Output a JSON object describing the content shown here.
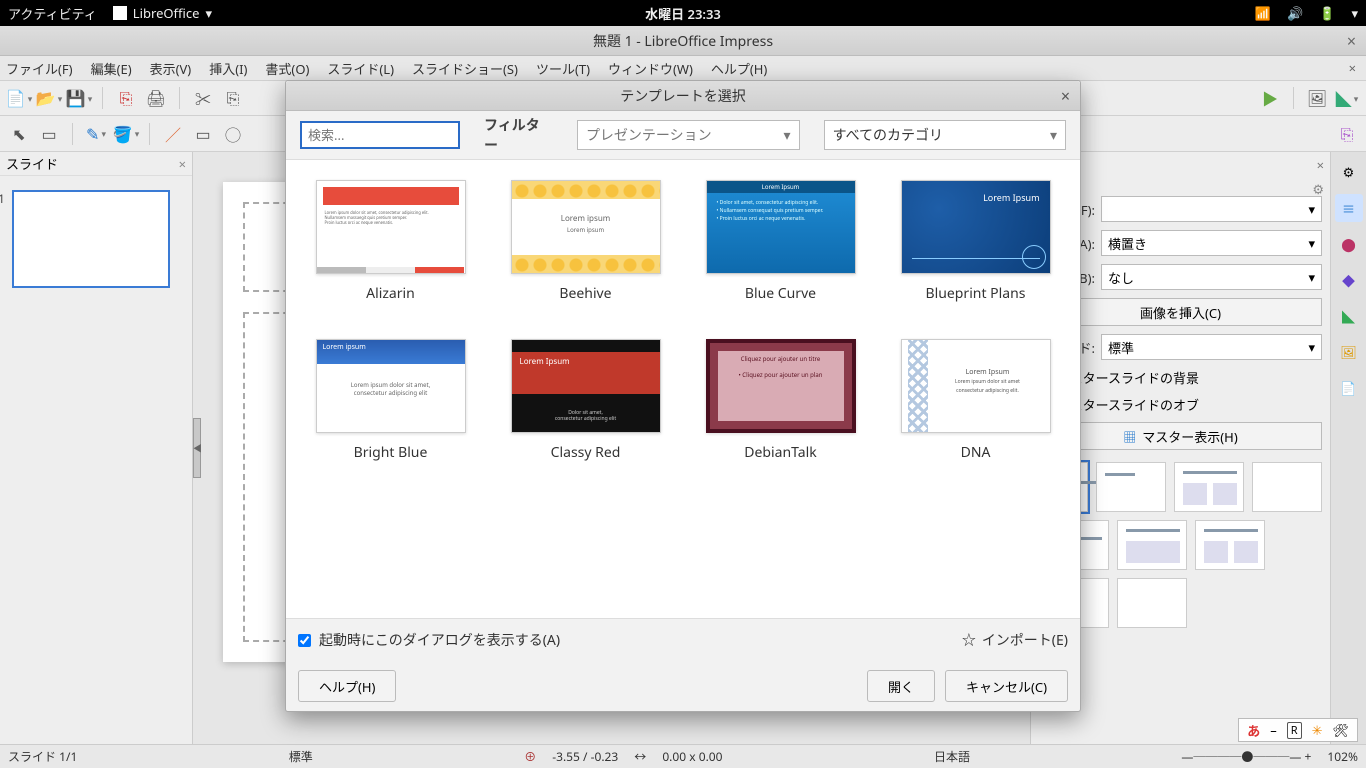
{
  "gnome": {
    "activities": "アクティビティ",
    "app": "LibreOffice",
    "clock": "水曜日 23:33"
  },
  "window": {
    "title": "無題 1 - LibreOffice Impress"
  },
  "menu": [
    "ファイル(F)",
    "編集(E)",
    "表示(V)",
    "挿入(I)",
    "書式(O)",
    "スライド(L)",
    "スライドショー(S)",
    "ツール(T)",
    "ウィンドウ(W)",
    "ヘルプ(H)"
  ],
  "slidepanel": {
    "title": "スライド",
    "selected_index": "1"
  },
  "sidebar": {
    "format_label": "式(F):",
    "format_value": "",
    "orientation_label": "き(A):",
    "orientation_value": "横置き",
    "background_label": "景(B):",
    "background_value": "なし",
    "insert_image_btn": "画像を挿入(C)",
    "slide_label": "イド:",
    "slide_value": "標準",
    "cb1": "マスタースライドの背景",
    "cb2": "マスタースライドのオブ",
    "master_btn": "マスター表示(H)"
  },
  "status": {
    "slide": "スライド 1/1",
    "style": "標準",
    "coords": "-3.55 / -0.23",
    "size": "0.00 x 0.00",
    "lang": "日本語",
    "zoom": "102%"
  },
  "dialog": {
    "title": "テンプレートを選択",
    "search_placeholder": "検索...",
    "filter_label": "フィルター",
    "filter_value": "プレゼンテーション",
    "category_value": "すべてのカテゴリ",
    "templates": [
      "Alizarin",
      "Beehive",
      "Blue Curve",
      "Blueprint Plans",
      "Bright Blue",
      "Classy Red",
      "DebianTalk",
      "DNA"
    ],
    "show_on_start": "起動時にこのダイアログを表示する(A)",
    "import": "インポート(E)",
    "help": "ヘルプ(H)",
    "open": "開く",
    "cancel": "キャンセル(C)"
  },
  "im_tray": {
    "a": "あ",
    "r": "R"
  }
}
